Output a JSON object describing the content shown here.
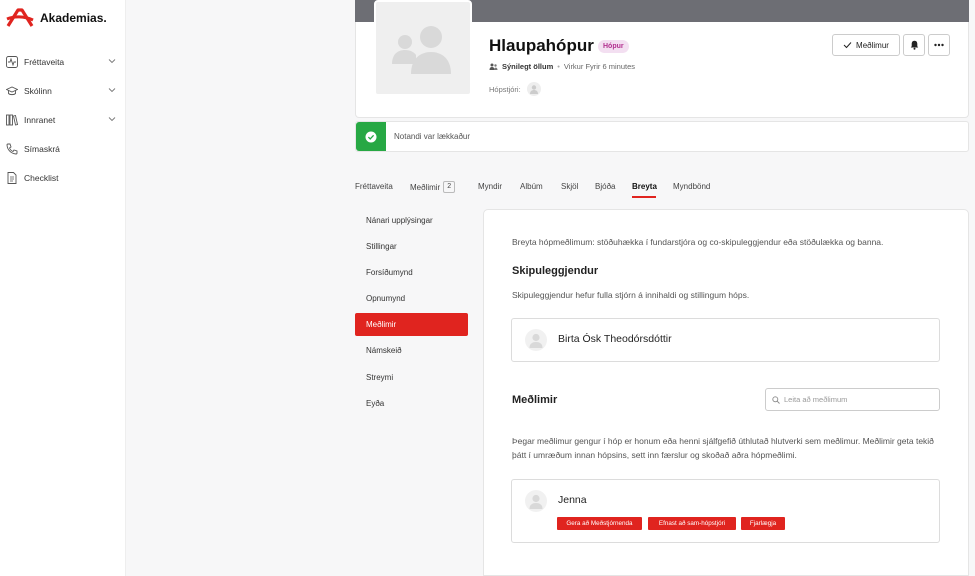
{
  "brand": {
    "name": "Akademias.",
    "color": "#e0241f"
  },
  "sidebar": {
    "items": [
      {
        "label": "Fréttaveita",
        "icon": "activity-icon",
        "has_chevron": true
      },
      {
        "label": "Skólinn",
        "icon": "graduation-cap-icon",
        "has_chevron": true
      },
      {
        "label": "Innranet",
        "icon": "library-icon",
        "has_chevron": true
      },
      {
        "label": "Símaskrá",
        "icon": "phone-icon",
        "has_chevron": false
      },
      {
        "label": "Checklist",
        "icon": "document-icon",
        "has_chevron": false
      }
    ]
  },
  "group": {
    "title": "Hlaupahópur",
    "type_badge": "Hópur",
    "visibility": "Sýnilegt öllum",
    "separator": "•",
    "activity": "Virkur Fyrir 6 minutes",
    "admin_label": "Hópstjóri:",
    "member_button": "Meðlimur"
  },
  "notice": {
    "text": "Notandi var lækkaður",
    "status_color": "#27a844"
  },
  "tabs": [
    {
      "label": "Fréttaveita"
    },
    {
      "label": "Meðlimir",
      "count": "2"
    },
    {
      "label": "Myndir"
    },
    {
      "label": "Albúm"
    },
    {
      "label": "Skjöl"
    },
    {
      "label": "Bjóða"
    },
    {
      "label": "Breyta",
      "active": true
    },
    {
      "label": "Myndbönd"
    }
  ],
  "settings_menu": [
    {
      "label": "Nánari upplýsingar"
    },
    {
      "label": "Stillingar"
    },
    {
      "label": "Forsíðumynd"
    },
    {
      "label": "Opnumynd"
    },
    {
      "label": "Meðlimir",
      "active": true
    },
    {
      "label": "Námskeið"
    },
    {
      "label": "Streymi"
    },
    {
      "label": "Eyða"
    }
  ],
  "panel": {
    "intro": "Breyta hópmeðlimum: stöðuhækka í fundarstjóra og co-skipuleggjendur eða stöðulækka og banna.",
    "organizers_heading": "Skipuleggjendur",
    "organizers_desc": "Skipuleggjendur hefur fulla stjórn á innihaldi og stillingum hóps.",
    "organizer_name": "Birta Ósk Theodórsdóttir",
    "members_heading": "Meðlimir",
    "search_placeholder": "Leita að meðlimum",
    "members_desc": "Þegar meðlimur gengur í hóp er honum eða henni sjálfgefið úthlutað hlutverki sem meðlimur. Meðlimir geta tekið þátt í umræðum innan hópsins, sett inn færslur og skoðað aðra hópmeðlimi.",
    "member_name": "Jenna",
    "actions": [
      "Gera að Meðstjórnenda",
      "Efnast að sam-hópstjóri",
      "Fjarlægja"
    ]
  }
}
